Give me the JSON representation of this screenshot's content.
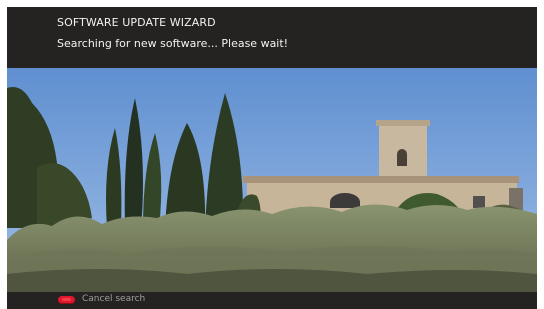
{
  "wizard": {
    "title": "SOFTWARE UPDATE WIZARD",
    "status": "Searching for new software... Please wait!"
  },
  "picture": {
    "description_icon": "tv-live-picture"
  },
  "footer": {
    "cancel_key_icon": "red-button-icon",
    "cancel_key_color": "#e1182c",
    "cancel_label": "Cancel search"
  }
}
